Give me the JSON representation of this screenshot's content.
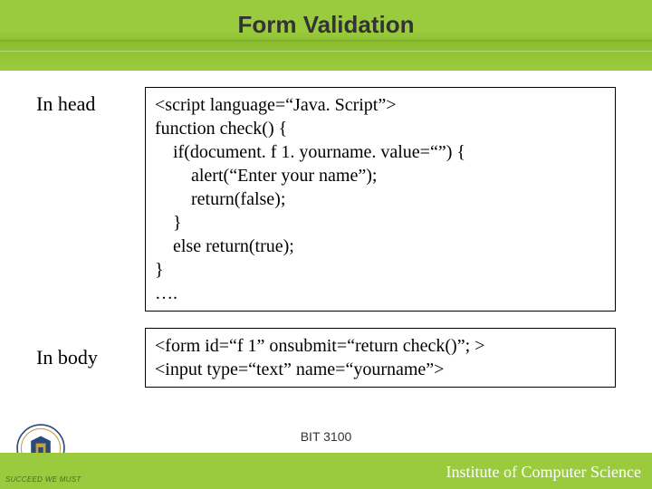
{
  "slide": {
    "title": "Form Validation",
    "course_code": "BIT 3100"
  },
  "blocks": {
    "head_label": "In head",
    "body_label": "In body",
    "head_code": "<script language=“Java. Script”>\nfunction check() {\n    if(document. f 1. yourname. value=“”) {\n        alert(“Enter your name”);\n        return(false);\n    }\n    else return(true);\n}\n….",
    "body_code": "<form id=“f 1” onsubmit=“return check()”; >\n<input type=“text” name=“yourname”>"
  },
  "footer": {
    "motto": "SUCCEED WE MUST",
    "institute": "Institute of Computer Science"
  }
}
